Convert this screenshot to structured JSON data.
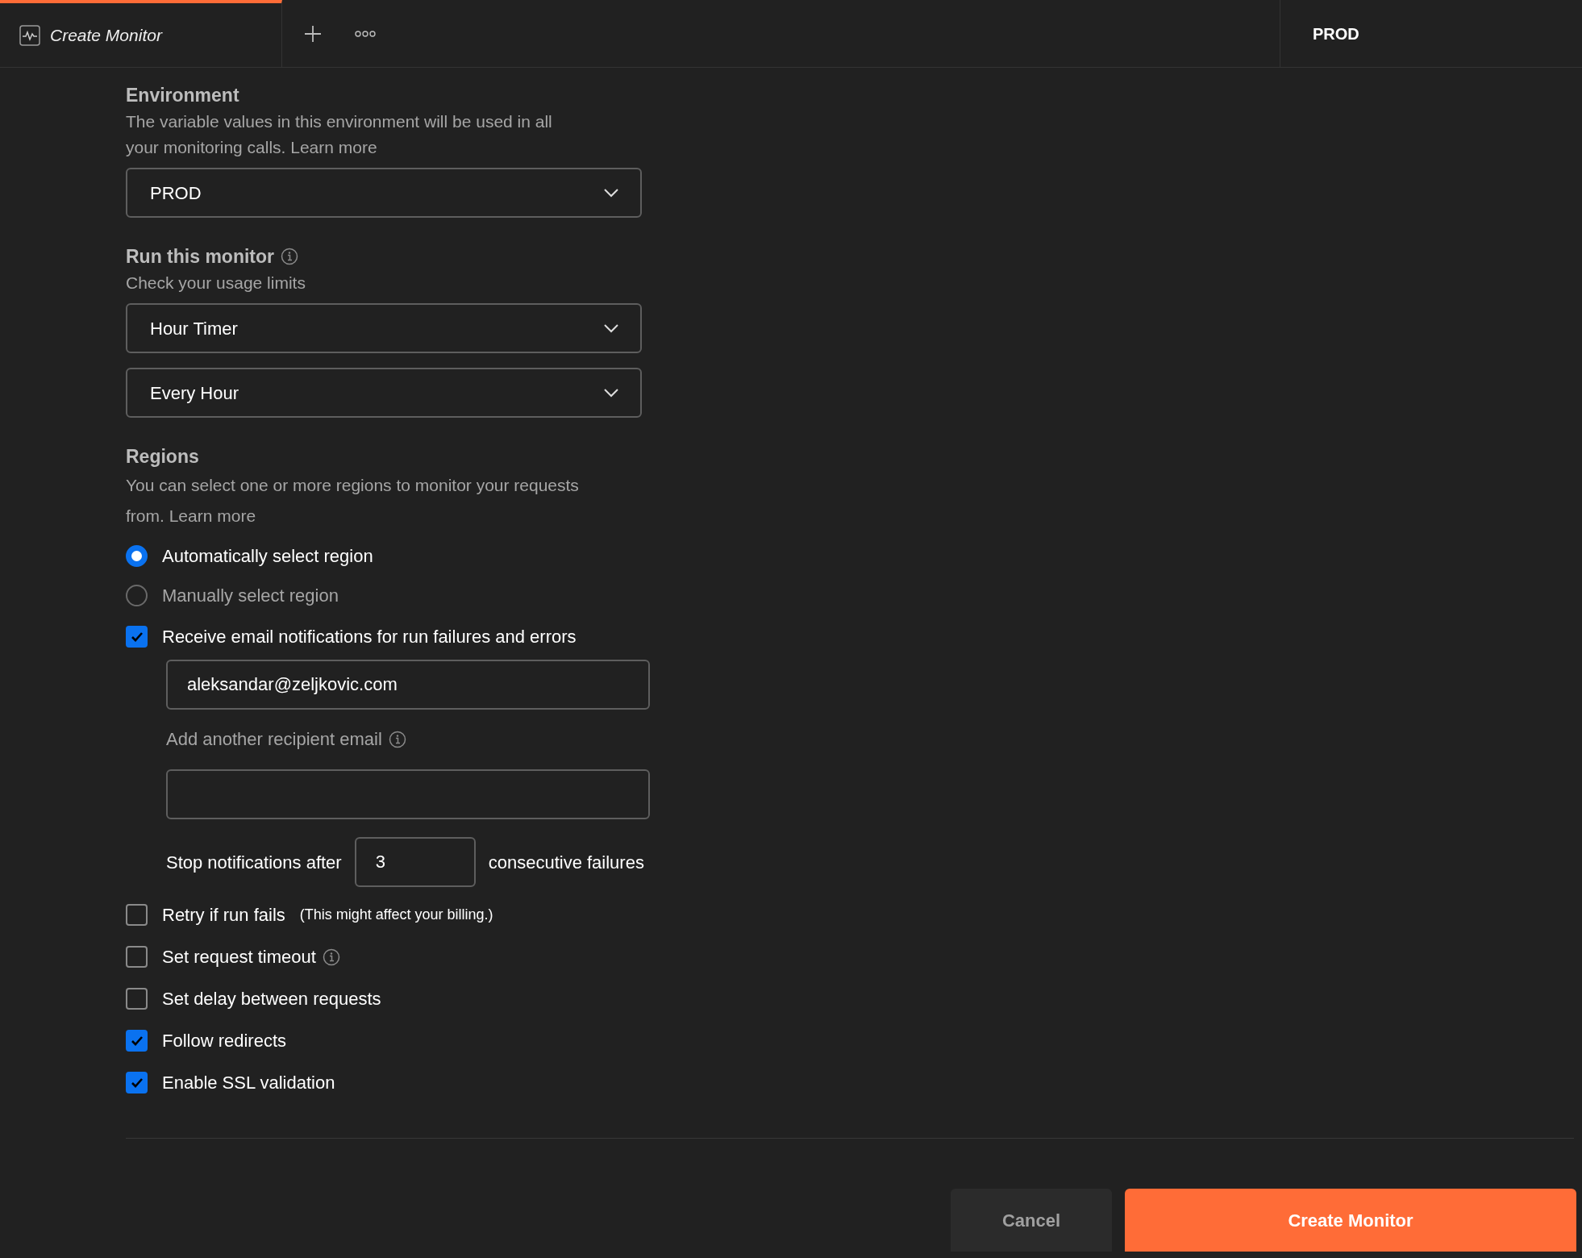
{
  "tabs": [
    {
      "title": "Create Monitor",
      "selected": true
    }
  ],
  "environment_tab": {
    "label": "PROD"
  },
  "environment": {
    "title": "Environment",
    "description": "The variable values in this environment will be used in all your monitoring calls.",
    "link": "Learn more",
    "select": "PROD"
  },
  "run_monitor": {
    "title": "Run this monitor",
    "info": true,
    "description": "Check your usage limits",
    "selects": [
      "Hour Timer",
      "Every Hour"
    ]
  },
  "regions": {
    "title": "Regions",
    "description": "You can select one or more regions to monitor your requests from.",
    "link": "Learn more",
    "options": [
      {
        "label": "Automatically select region",
        "selected": true
      },
      {
        "label": "Manually select region",
        "selected": false
      }
    ]
  },
  "notifications": {
    "label": "Receive email notifications for run failures and errors",
    "checked": true,
    "email": "aleksandar@zeljkovic.com",
    "another_label": "Add another recipient email",
    "another_info": true,
    "stop_prefix": "Stop notifications after",
    "stop_value": "3",
    "stop_suffix": "consecutive failures"
  },
  "options": [
    {
      "label": "Retry if run fails",
      "checked": false,
      "note": "(This might affect your billing.)",
      "info": false
    },
    {
      "label": "Set request timeout",
      "checked": false,
      "info": true
    },
    {
      "label": "Set delay between requests",
      "checked": false,
      "info": false
    },
    {
      "label": "Follow redirects",
      "checked": true,
      "info": false
    },
    {
      "label": "Enable SSL validation",
      "checked": true,
      "info": false
    }
  ],
  "buttons": [
    {
      "label": "Cancel",
      "kind": "secondary"
    },
    {
      "label": "Create Monitor",
      "kind": "primary"
    }
  ]
}
